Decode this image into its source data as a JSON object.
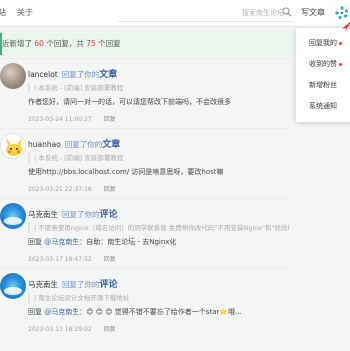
{
  "nav": {
    "about": "关于",
    "partial": "站"
  },
  "search": {
    "placeholder": "搜索南生论坛"
  },
  "header": {
    "write": "写文章"
  },
  "banner": {
    "prefix": "近新增了",
    "new_count": "60",
    "middle": "个回复，共",
    "total_count": "75",
    "suffix": "个回复"
  },
  "menu": {
    "items": [
      {
        "label": "回复我的",
        "has_dot": true
      },
      {
        "label": "收到的赞",
        "has_dot": true
      },
      {
        "label": "新增粉丝",
        "has_dot": false
      },
      {
        "label": "系统通知",
        "has_dot": false
      }
    ]
  },
  "notifications": [
    {
      "user": "lancelot",
      "action": "回复了你的",
      "kind": "文章",
      "quote": "| 本系统 - [前端] 安装部署教程",
      "content": "作者您好，请问一对一的话，可以请您帮改下前端吗，不会改很多",
      "time": "2023-03-24 11:00:27",
      "reply": "回复"
    },
    {
      "user": "huanhao",
      "action": "回复了你的",
      "kind": "文章",
      "quote": "| 本系统 - [前端] 安装部署教程",
      "content": "使用http://bbs.localhost.com/ 访问是啥意思呀，要改host嘛",
      "time": "2023-03-21 22:37:18",
      "reply": "回复"
    },
    {
      "user": "马克南生",
      "action": "回复了你的",
      "kind": "评论",
      "quote": "| 不愿意使用nginx（域名访问）的同学联系我 免费帮你改代码\"不用安装Nginx\"和\"修改host...",
      "reply_prefix": "回复",
      "mention": "@马克南生",
      "content": "：自助：南生论坛 - 去Nginx化",
      "time": "2023-03-17 16:47:52",
      "reply": "回复"
    },
    {
      "user": "马克南生",
      "action": "回复了你的",
      "kind": "评论",
      "quote": "| 南生论坛设计文档开源下载地址",
      "reply_prefix": "回复",
      "mention": "@马克南生",
      "content": "：😊 😊 😊 觉得不错不要忘了给作者一个star⭐哦...",
      "time": "2023-03-13 18:29:02",
      "reply": "回复"
    }
  ]
}
